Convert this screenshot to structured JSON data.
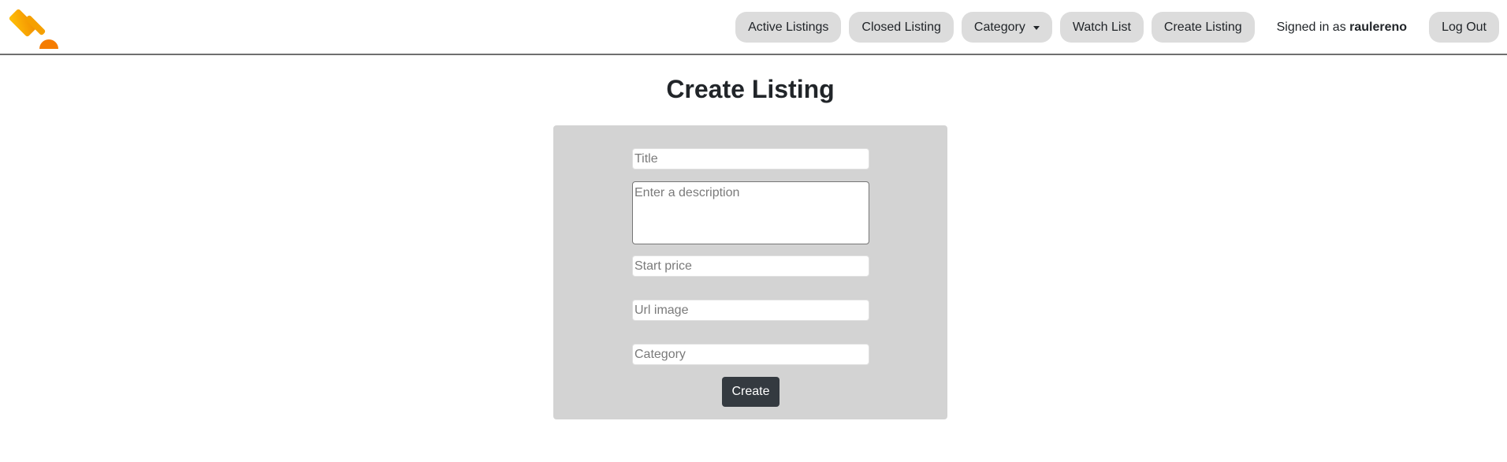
{
  "nav": {
    "logo_icon": "gavel-icon",
    "items": [
      {
        "label": "Active Listings"
      },
      {
        "label": "Closed Listing"
      },
      {
        "label": "Category"
      },
      {
        "label": "Watch List"
      },
      {
        "label": "Create Listing"
      }
    ],
    "signed_in_prefix": "Signed in as",
    "username": "raulereno",
    "logout_label": "Log Out"
  },
  "page": {
    "title": "Create Listing"
  },
  "form": {
    "title_placeholder": "Title",
    "description_placeholder": "Enter a description",
    "price_placeholder": "Start price",
    "image_placeholder": "Url image",
    "category_placeholder": "Category",
    "submit_label": "Create"
  },
  "colors": {
    "logo_orange": "#f7a400",
    "card_bg": "#d3d3d3",
    "button_dark": "#343a40",
    "pill_bg": "#dcdcdc"
  }
}
